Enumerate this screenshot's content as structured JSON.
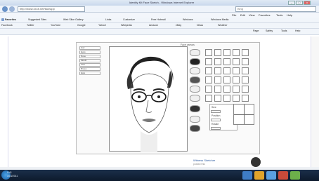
{
  "window": {
    "title": "Identity Kit Face Sketch - Windows Internet Explorer",
    "min": "_",
    "max": "□",
    "close": "x"
  },
  "address": {
    "url": "http://www.id.kit.net/faceapp",
    "search": "Bing"
  },
  "menu": [
    "File",
    "Edit",
    "View",
    "Favorites",
    "Tools",
    "Help"
  ],
  "toolbar1": [
    "Favorites",
    "Suggested Sites",
    "Web Slice Gallery",
    "Links",
    "Customize",
    "Free Hotmail",
    "Windows",
    "Windows Media"
  ],
  "toolbar2": [
    "Facebook",
    "Twitter",
    "YouTube",
    "Google",
    "Yahoo!",
    "Wikipedia",
    "Amazon",
    "eBay",
    "News",
    "Weather"
  ],
  "toolbar3": [
    "Page",
    "Safety",
    "Tools",
    "Help"
  ],
  "app": {
    "canvas_label": "Face canvas",
    "left_panel": [
      "Hair",
      "Eyes",
      "Nose",
      "Mouth",
      "Chin",
      "Brows",
      "Ears"
    ],
    "tools_labels": [
      "Size",
      "Position",
      "Rotate"
    ],
    "post_name": "Witness Sketcher",
    "post_sub": "posted this"
  },
  "taskbar": {
    "time": "9:41",
    "date": "3/14/2011"
  },
  "colors": {
    "taskbar": "#13243b",
    "accent": "#2a5aa0"
  }
}
